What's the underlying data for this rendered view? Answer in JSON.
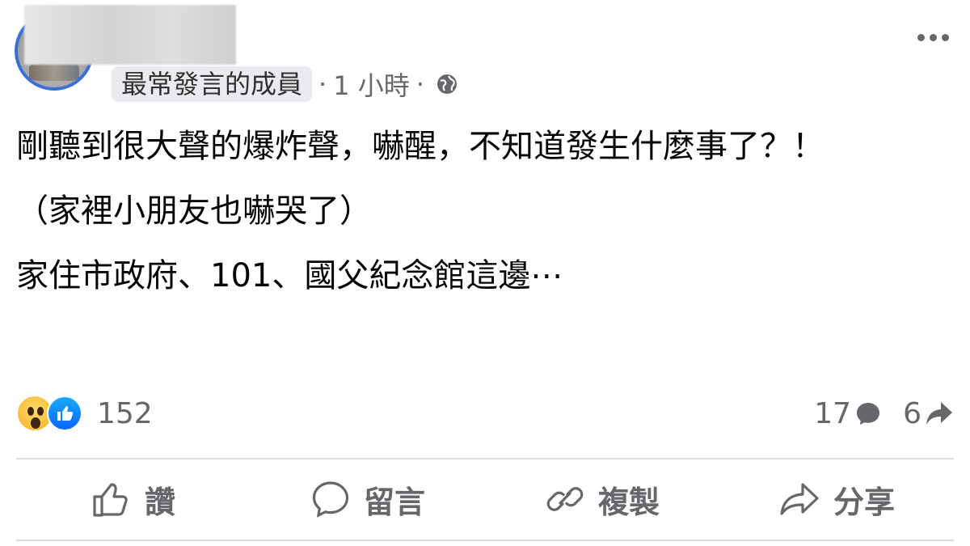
{
  "header": {
    "member_badge": "最常發言的成員",
    "separator": "·",
    "time": "1 小時",
    "privacy_icon": "globe-icon",
    "more_icon": "more-horizontal-icon"
  },
  "post": {
    "paragraphs": [
      "剛聽到很大聲的爆炸聲，嚇醒，不知道發生什麼事了？！",
      "（家裡小朋友也嚇哭了）",
      "家住市政府、101、國父紀念館這邊⋯"
    ]
  },
  "stats": {
    "reaction_icons": [
      "wow-icon",
      "like-icon"
    ],
    "reaction_count": "152",
    "comment_count": "17",
    "share_count": "6"
  },
  "actions": {
    "like_label": "讚",
    "comment_label": "留言",
    "copy_label": "複製",
    "share_label": "分享"
  },
  "colors": {
    "secondary_text": "#65676b",
    "like_blue": "#0866ff",
    "wow_yellow": "#f7b125",
    "divider": "#dadde1",
    "avatar_ring": "#3b6fd8"
  }
}
